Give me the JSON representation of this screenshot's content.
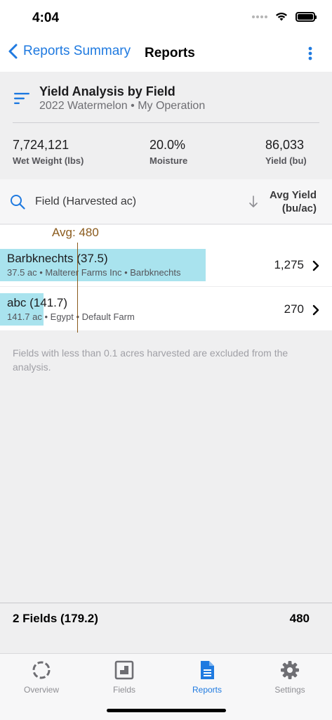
{
  "status": {
    "time": "4:04"
  },
  "nav": {
    "back_label": "Reports Summary",
    "title": "Reports"
  },
  "report": {
    "title": "Yield Analysis by Field",
    "subtitle": "2022 Watermelon • My Operation",
    "stats": [
      {
        "value": "7,724,121",
        "label": "Wet Weight (lbs)"
      },
      {
        "value": "20.0%",
        "label": "Moisture"
      },
      {
        "value": "86,033",
        "label": "Yield (bu)"
      }
    ]
  },
  "list_header": {
    "field_label": "Field (Harvested ac)",
    "yield_label_1": "Avg Yield",
    "yield_label_2": "(bu/ac)"
  },
  "average": {
    "label": "Avg: 480",
    "value": 480
  },
  "rows": [
    {
      "name": "Barbknechts (37.5)",
      "meta": "37.5 ac • Malterer Farms Inc • Barbknechts",
      "value": "1,275",
      "yield": 1275
    },
    {
      "name": "abc (141.7)",
      "meta": "141.7 ac • Egypt • Default Farm",
      "value": "270",
      "yield": 270
    }
  ],
  "footnote": "Fields with less than 0.1 acres harvested are excluded from the analysis.",
  "summary": {
    "label": "2 Fields (179.2)",
    "value": "480"
  },
  "tabs": [
    {
      "label": "Overview",
      "icon": "overview-ring-icon",
      "active": false
    },
    {
      "label": "Fields",
      "icon": "fields-map-icon",
      "active": false
    },
    {
      "label": "Reports",
      "icon": "reports-document-icon",
      "active": true
    },
    {
      "label": "Settings",
      "icon": "gear-icon",
      "active": false
    }
  ],
  "colors": {
    "accent": "#1f7ae0",
    "bar": "#a9e3ee",
    "average_line": "#8a5a1c"
  }
}
